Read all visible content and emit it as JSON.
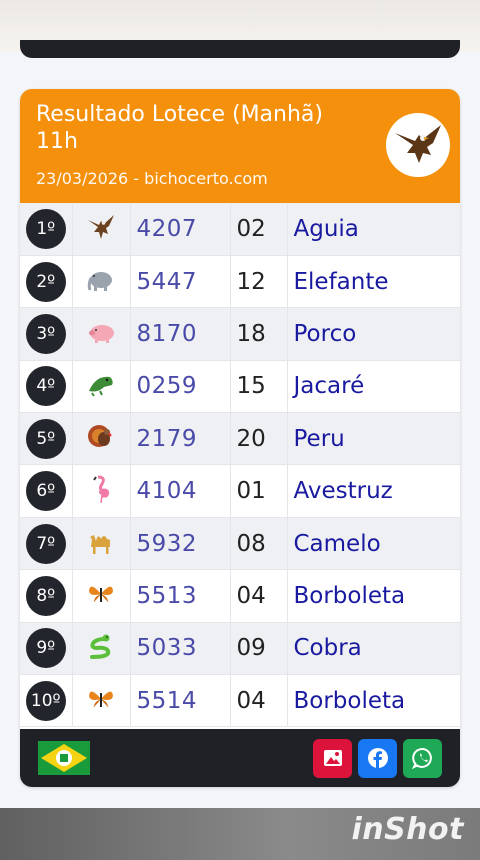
{
  "card": {
    "title": "Resultado Lotece (Manhã) 11h",
    "subtitle": "23/03/2026 - bichocerto.com",
    "badge_icon": "eagle-icon"
  },
  "results": [
    {
      "position": "1º",
      "icon": "eagle-icon",
      "milhar": "4207",
      "grupo": "02",
      "animal": "Aguia"
    },
    {
      "position": "2º",
      "icon": "elephant-icon",
      "milhar": "5447",
      "grupo": "12",
      "animal": "Elefante"
    },
    {
      "position": "3º",
      "icon": "pig-icon",
      "milhar": "8170",
      "grupo": "18",
      "animal": "Porco"
    },
    {
      "position": "4º",
      "icon": "crocodile-icon",
      "milhar": "0259",
      "grupo": "15",
      "animal": "Jacaré"
    },
    {
      "position": "5º",
      "icon": "turkey-icon",
      "milhar": "2179",
      "grupo": "20",
      "animal": "Peru"
    },
    {
      "position": "6º",
      "icon": "flamingo-icon",
      "milhar": "4104",
      "grupo": "01",
      "animal": "Avestruz"
    },
    {
      "position": "7º",
      "icon": "camel-icon",
      "milhar": "5932",
      "grupo": "08",
      "animal": "Camelo"
    },
    {
      "position": "8º",
      "icon": "butterfly-icon",
      "milhar": "5513",
      "grupo": "04",
      "animal": "Borboleta"
    },
    {
      "position": "9º",
      "icon": "snake-icon",
      "milhar": "5033",
      "grupo": "09",
      "animal": "Cobra"
    },
    {
      "position": "10º",
      "icon": "butterfly-icon",
      "milhar": "5514",
      "grupo": "04",
      "animal": "Borboleta"
    }
  ],
  "footer": {
    "flag_icon": "ceara-flag-icon",
    "buttons": [
      {
        "icon": "image-icon",
        "color": "#dc143c"
      },
      {
        "icon": "facebook-icon",
        "color": "#1877f2"
      },
      {
        "icon": "whatsapp-icon",
        "color": "#1fa855"
      }
    ]
  },
  "watermark": "inShot",
  "colors": {
    "header_orange": "#f4900c",
    "dark": "#1f2126",
    "milhar_text": "#4a4aa8",
    "animal_text": "#1a1aa0"
  }
}
